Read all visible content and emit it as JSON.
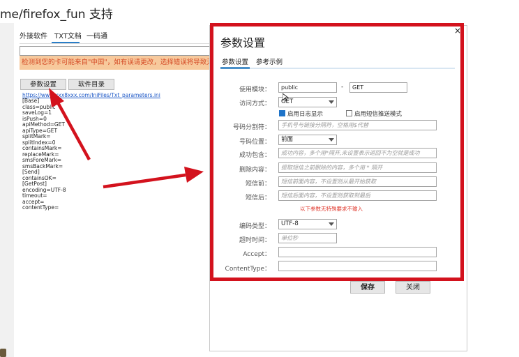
{
  "window": {
    "title": "me/firefox_fun 支持"
  },
  "tabs": [
    {
      "label": "外接软件"
    },
    {
      "label": "TXT文档",
      "active": true
    },
    {
      "label": "一码通"
    }
  ],
  "warning_text": "检测到您的卡可能来自\"中国\"，如有误请更改，选择错误将导致无法",
  "buttons": {
    "params": "参数设置",
    "catalog": "软件目录"
  },
  "txt": {
    "link": "https://www.xxx8xxx.com/IniFiles/Txt_parameters.ini",
    "lines": [
      "[Base]",
      "class=public",
      "saveLog=1",
      "isPush=0",
      "apiMethod=GET",
      "apiType=GET",
      "splitMark=",
      "splitIndex=0",
      "containsMark=",
      "replaceMark=",
      "smsForeMark=",
      "smsBackMark=",
      "[Send]",
      "containsOK=",
      "[GetPost]",
      "encoding=UTF-8",
      "timeout=",
      "accept=",
      "contentType="
    ]
  },
  "dialog": {
    "title": "参数设置",
    "close": "×",
    "tabs": [
      {
        "label": "参数设置",
        "active": true
      },
      {
        "label": "参考示例"
      }
    ],
    "module_label": "使用模块：",
    "module_value": "public",
    "module_sep": "-",
    "module_value2": "GET",
    "access_label": "访问方式：",
    "access_value": "GET",
    "chk_log": "启用日志显示",
    "chk_log_checked": true,
    "chk_push": "启用短信推送模式",
    "chk_push_checked": false,
    "split_label": "号码分割符：",
    "split_placeholder": "手机号与链接分隔符，空格用$代替",
    "pos_label": "号码位置：",
    "pos_value": "前面",
    "success_label": "成功包含：",
    "success_placeholder": "成功内容，多个用*隔开,未设置表示返回不为空就是成功",
    "delete_label": "删除内容：",
    "delete_placeholder": "提取短信之前删除的内容，多个用 * 隔开",
    "before_label": "短信前：",
    "before_placeholder": "短信前面内容，不设置则从最开始获取",
    "after_label": "短信后：",
    "after_placeholder": "短信后面内容，不设置则获取到最后",
    "note": "以下参数无特殊要求不输入",
    "encoding_label": "编码类型：",
    "encoding_value": "UTF-8",
    "timeout_label": "超时时间：",
    "timeout_placeholder": "单位秒",
    "accept_label": "Accept：",
    "content_type_label": "ContentType：",
    "save": "保存",
    "cancel": "关闭"
  },
  "colors": {
    "annotation_red": "#d3121d",
    "accent": "#2a7ec7",
    "warning_bg": "#f7c99c",
    "warning_text": "#d44a25"
  }
}
